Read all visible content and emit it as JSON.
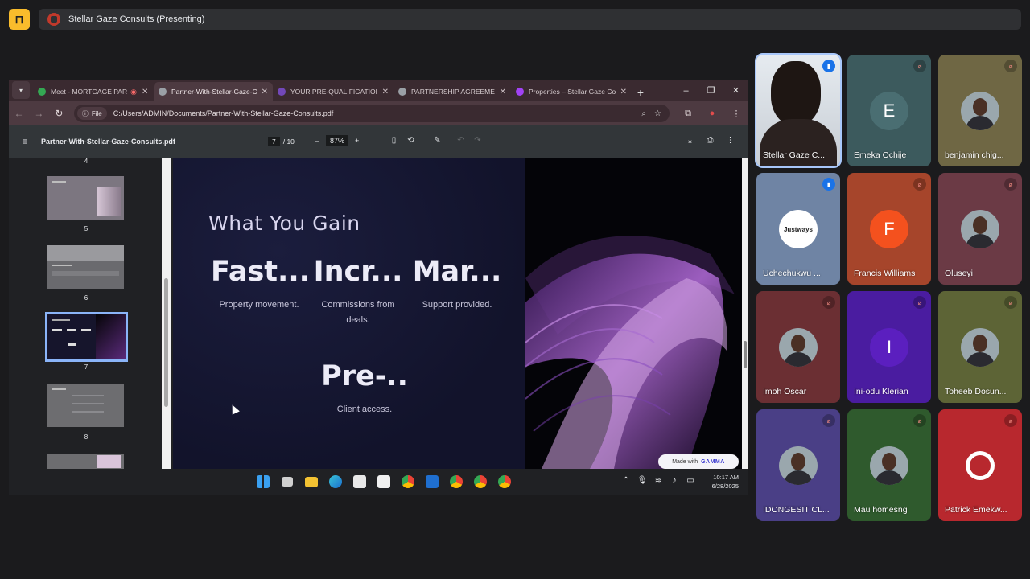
{
  "meet": {
    "presenting_title": "Stellar Gaze Consults (Presenting)"
  },
  "browser": {
    "tabs": [
      {
        "label": "Meet - MORTGAGE PAR",
        "fav_color": "#34a853",
        "active": false,
        "recording": true
      },
      {
        "label": "Partner-With-Stellar-Gaze-C",
        "fav_color": "#9aa0a6",
        "active": true,
        "recording": false
      },
      {
        "label": "YOUR PRE-QUALIFICATION",
        "fav_color": "#7248b9",
        "active": false,
        "recording": false
      },
      {
        "label": "PARTNERSHIP AGREEMENT",
        "fav_color": "#9aa0a6",
        "active": false,
        "recording": false
      },
      {
        "label": "Properties – Stellar Gaze Co",
        "fav_color": "#a142f4",
        "active": false,
        "recording": false
      }
    ],
    "file_chip": "File",
    "url": "C:/Users/ADMIN/Documents/Partner-With-Stellar-Gaze-Consults.pdf"
  },
  "pdf": {
    "title": "Partner-With-Stellar-Gaze-Consults.pdf",
    "current_page": "7",
    "total_pages": "/ 10",
    "zoom": "87%",
    "thumbnails": [
      {
        "label": "4"
      },
      {
        "label": "5"
      },
      {
        "label": "6"
      },
      {
        "label": "7"
      },
      {
        "label": "8"
      }
    ]
  },
  "slide": {
    "heading": "What You Gain",
    "items": [
      {
        "big": "Fast...",
        "small": "Property movement."
      },
      {
        "big": "Incr...",
        "small": "Commissions from deals."
      },
      {
        "big": "Mar...",
        "small": "Support provided."
      },
      {
        "big": "Pre-..",
        "small": "Client access."
      }
    ],
    "made_with": "Made with",
    "made_with_brand": "GAMMA"
  },
  "taskbar": {
    "time": "10:17 AM",
    "date": "6/28/2025"
  },
  "participants": [
    {
      "name": "Stellar Gaze C...",
      "type": "photo",
      "mic": "talk",
      "bg": "#c9cfd6",
      "speaking": true
    },
    {
      "name": "Emeka Ochije",
      "type": "letter",
      "letter": "E",
      "avatar_bg": "#4a6e72",
      "bg": "#3c5a5d",
      "mic": "off"
    },
    {
      "name": "benjamin chig...",
      "type": "photo",
      "bg": "#6f6744",
      "mic": "off"
    },
    {
      "name": "Uchechukwu ...",
      "type": "logo",
      "logo_text": "Justways",
      "bg": "#6f84a4",
      "mic": "talk"
    },
    {
      "name": "Francis Williams",
      "type": "letter",
      "letter": "F",
      "avatar_bg": "#f4511e",
      "bg": "#a6452b",
      "mic": "off"
    },
    {
      "name": "Oluseyi",
      "type": "photo",
      "bg": "#6b3a45",
      "mic": "off"
    },
    {
      "name": "Imoh Oscar",
      "type": "photo",
      "bg": "#6b2f33",
      "mic": "off"
    },
    {
      "name": "Ini-odu Klerian",
      "type": "letter",
      "letter": "I",
      "avatar_bg": "#5b1fbf",
      "bg": "#4a1ca0",
      "mic": "off"
    },
    {
      "name": "Toheeb Dosun...",
      "type": "photo",
      "bg": "#5d6436",
      "mic": "off"
    },
    {
      "name": "IDONGESIT CL...",
      "type": "photo",
      "bg": "#4a3f86",
      "mic": "off"
    },
    {
      "name": "Mau homesng",
      "type": "photo",
      "bg": "#2f5a2d",
      "mic": "off"
    },
    {
      "name": "Patrick Emekw...",
      "type": "logo-red",
      "bg": "#b8282e",
      "mic": "off"
    }
  ]
}
